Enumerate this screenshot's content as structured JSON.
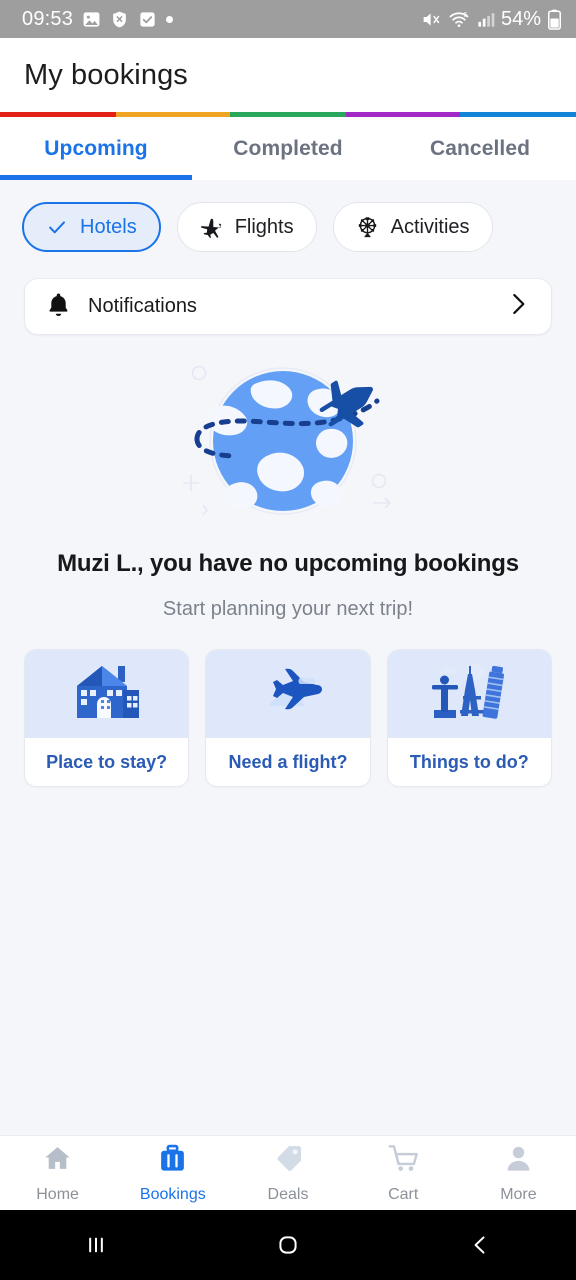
{
  "status_bar": {
    "time": "09:53",
    "battery_percent": "54%",
    "left_icons": [
      "image-icon",
      "shield-x-icon",
      "checkbox-icon",
      "dot-icon"
    ],
    "right_icons": [
      "mute-icon",
      "wifi-6-icon",
      "signal-bars-icon",
      "battery-icon"
    ]
  },
  "header": {
    "title": "My bookings"
  },
  "stripe_colors": [
    "#E32119",
    "#EFA521",
    "#28A65B",
    "#A229C6",
    "#1184D8"
  ],
  "tabs": [
    {
      "label": "Upcoming",
      "active": true
    },
    {
      "label": "Completed",
      "active": false
    },
    {
      "label": "Cancelled",
      "active": false
    }
  ],
  "chips": [
    {
      "label": "Hotels",
      "icon": "check-icon",
      "selected": true
    },
    {
      "label": "Flights",
      "icon": "airplane-icon",
      "selected": false
    },
    {
      "label": "Activities",
      "icon": "ferris-wheel-icon",
      "selected": false
    }
  ],
  "notifications": {
    "label": "Notifications",
    "icon": "bell-icon",
    "chevron": "chevron-right-icon"
  },
  "illustration": {
    "name": "globe-with-airplane-illustration"
  },
  "empty_state": {
    "title": "Muzi L., you have no upcoming bookings",
    "subtitle": "Start planning your next trip!"
  },
  "action_cards": [
    {
      "label": "Place to stay?",
      "icon": "house-icon"
    },
    {
      "label": "Need a flight?",
      "icon": "departing-plane-icon"
    },
    {
      "label": "Things to do?",
      "icon": "landmarks-icon"
    }
  ],
  "bottom_nav": [
    {
      "label": "Home",
      "icon": "home-icon",
      "active": false
    },
    {
      "label": "Bookings",
      "icon": "suitcase-icon",
      "active": true
    },
    {
      "label": "Deals",
      "icon": "tag-icon",
      "active": false
    },
    {
      "label": "Cart",
      "icon": "cart-icon",
      "active": false
    },
    {
      "label": "More",
      "icon": "person-icon",
      "active": false
    }
  ],
  "android_nav": [
    {
      "name": "recents-button",
      "glyph": "|||"
    },
    {
      "name": "home-button",
      "glyph": "▢"
    },
    {
      "name": "back-button",
      "glyph": "‹"
    }
  ],
  "colors": {
    "accent": "#1a73e8",
    "background": "#F4F6FA",
    "card_top": "#DFE7FA",
    "chip_selected_bg": "#E5EDFB",
    "globe_blue": "#63A0F5",
    "plane_navy": "#174EA6"
  }
}
